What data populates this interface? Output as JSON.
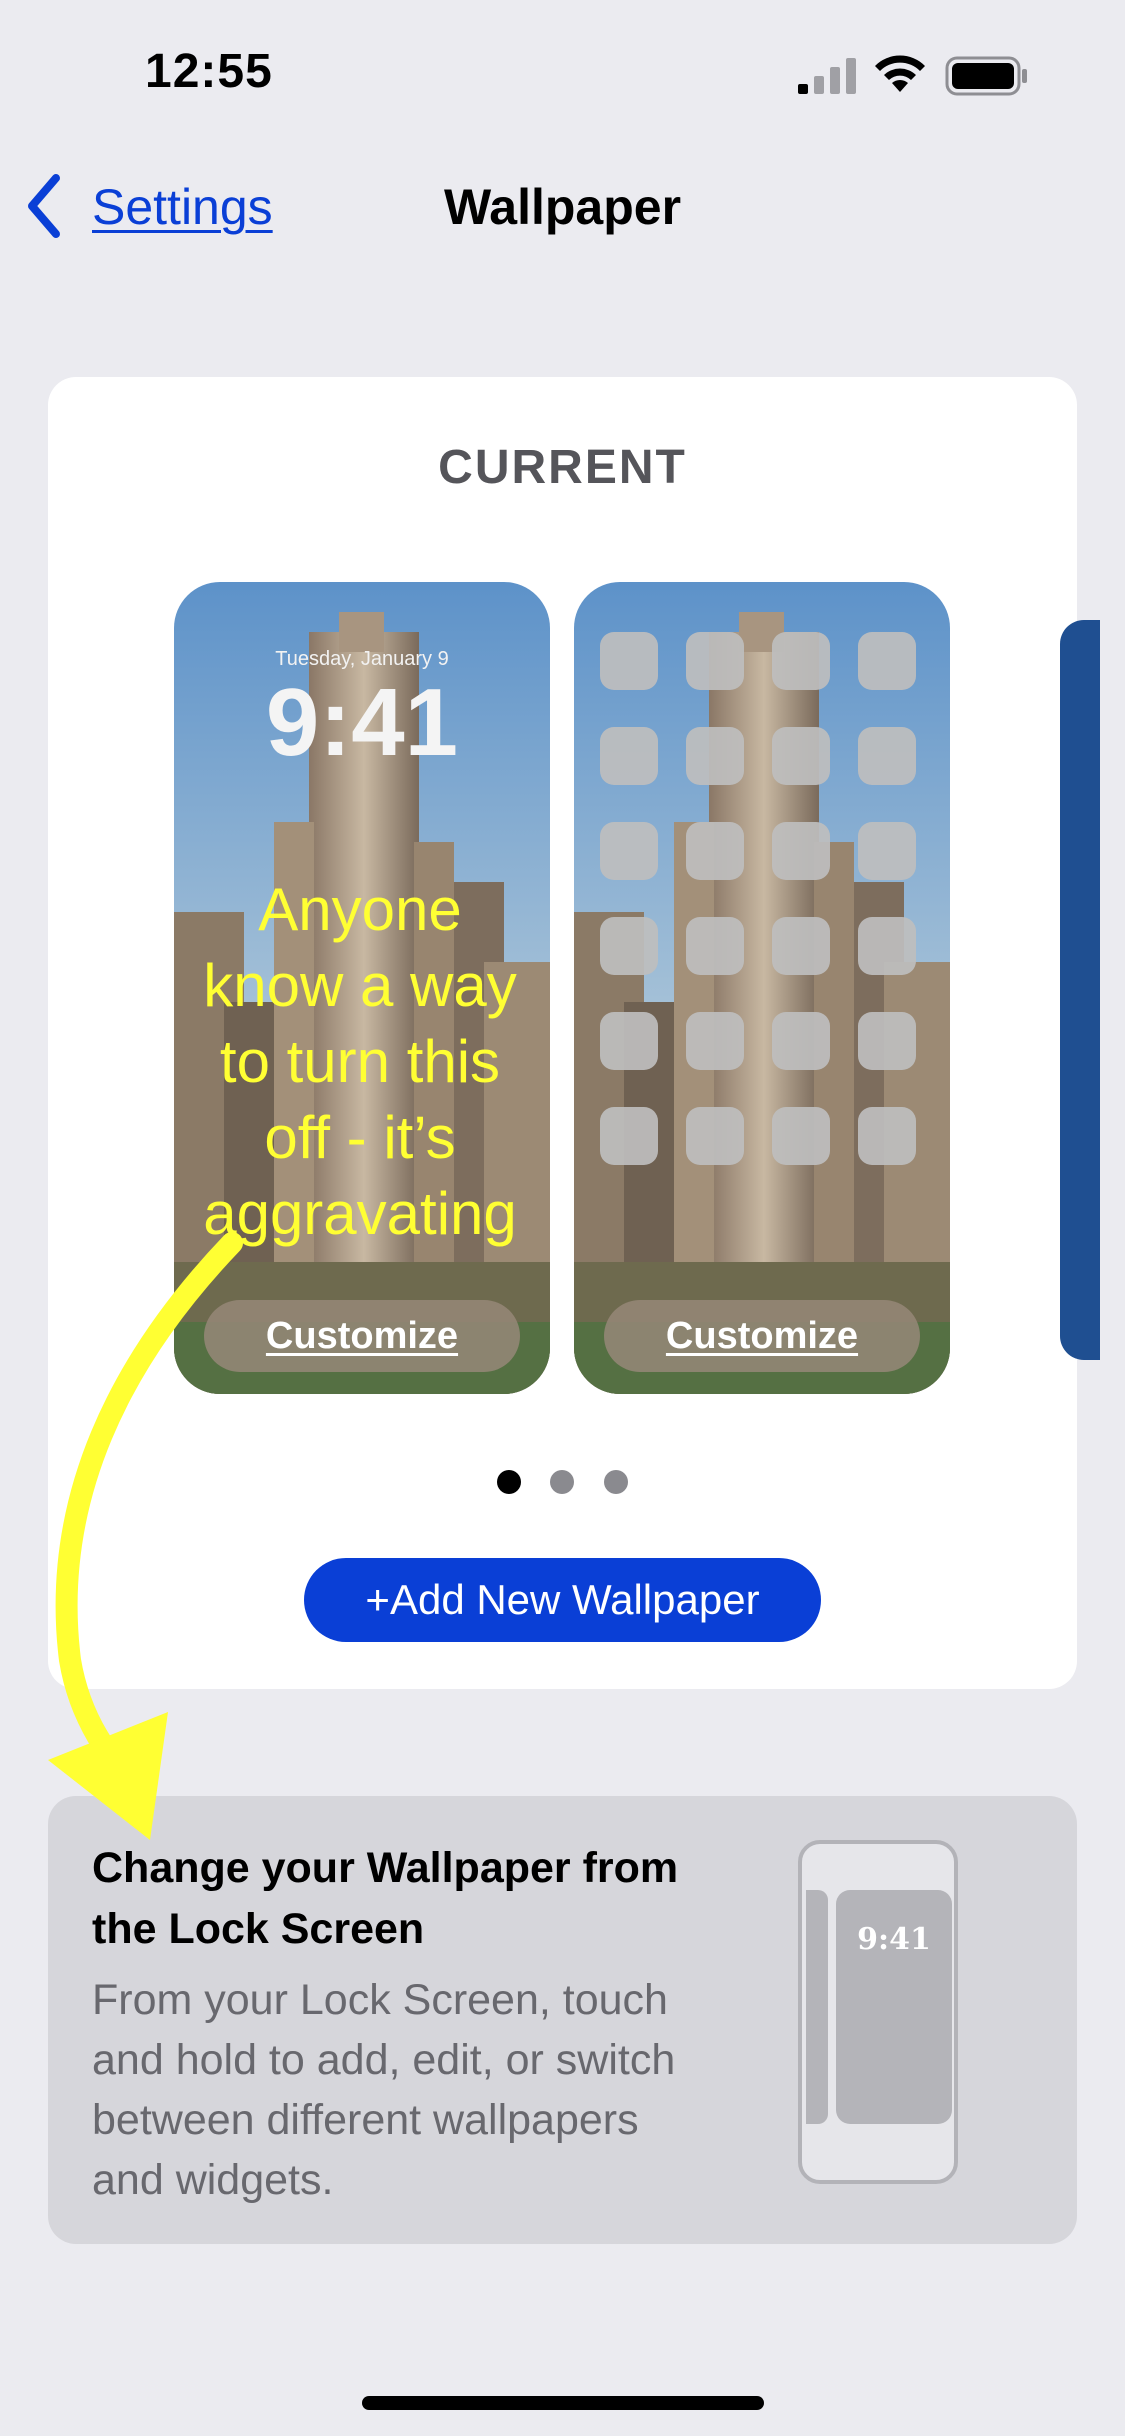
{
  "status_bar": {
    "time": "12:55"
  },
  "nav": {
    "back_label": "Settings",
    "title": "Wallpaper"
  },
  "current": {
    "heading": "CURRENT",
    "lock_preview": {
      "date": "Tuesday, January 9",
      "time": "9:41",
      "customize_label": "Customize"
    },
    "home_preview": {
      "customize_label": "Customize"
    },
    "page_count": 3,
    "active_page": 0,
    "add_button_label": "+Add New Wallpaper"
  },
  "annotation": {
    "lines": [
      "Anyone",
      "know a way",
      "to turn this",
      "off - it’s",
      "aggravating"
    ],
    "color": "#ffff33"
  },
  "tip": {
    "title": "Change your Wallpaper from the Lock Screen",
    "body": "From your Lock Screen, touch and hold to add, edit, or switch between different wallpapers and widgets.",
    "illustration_time": "9:41"
  },
  "colors": {
    "accent": "#0a3fd6",
    "background": "#ebebf0"
  },
  "icons": [
    "chevron-left-icon",
    "signal-icon",
    "wifi-icon",
    "battery-icon"
  ]
}
